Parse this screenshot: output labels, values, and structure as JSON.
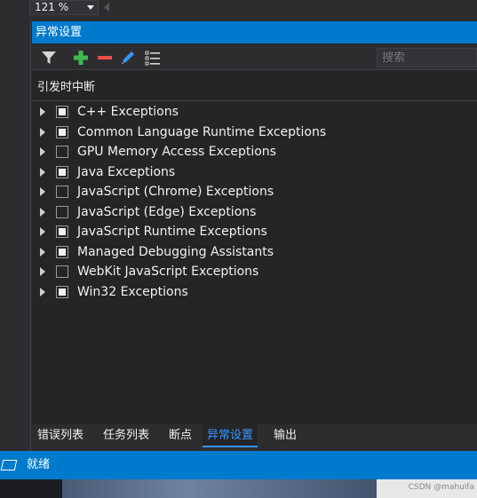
{
  "toolbar_top": {
    "zoom_value": "121 %"
  },
  "panel": {
    "title": "异常设置",
    "search_placeholder": "搜索",
    "header": "引发时中断",
    "icons": [
      "filter-icon",
      "add-icon",
      "remove-icon",
      "edit-icon",
      "restore-list-icon"
    ],
    "colors": {
      "accent": "#007acc",
      "add": "#3fb950",
      "remove": "#f14c4c",
      "edit": "#3794ff"
    }
  },
  "exceptions": [
    {
      "label": "C++ Exceptions",
      "checked": true
    },
    {
      "label": "Common Language Runtime Exceptions",
      "checked": true
    },
    {
      "label": "GPU Memory Access Exceptions",
      "checked": false
    },
    {
      "label": "Java Exceptions",
      "checked": true
    },
    {
      "label": "JavaScript (Chrome) Exceptions",
      "checked": false
    },
    {
      "label": "JavaScript (Edge) Exceptions",
      "checked": false
    },
    {
      "label": "JavaScript Runtime Exceptions",
      "checked": true
    },
    {
      "label": "Managed Debugging Assistants",
      "checked": true
    },
    {
      "label": "WebKit JavaScript Exceptions",
      "checked": false
    },
    {
      "label": "Win32 Exceptions",
      "checked": true
    }
  ],
  "tabs": [
    {
      "label": "错误列表",
      "active": false
    },
    {
      "label": "任务列表",
      "active": false
    },
    {
      "label": "断点",
      "active": false
    },
    {
      "label": "异常设置",
      "active": true
    },
    {
      "label": "输出",
      "active": false
    }
  ],
  "status": {
    "text": "就绪"
  },
  "watermark": "CSDN @mahuifa"
}
